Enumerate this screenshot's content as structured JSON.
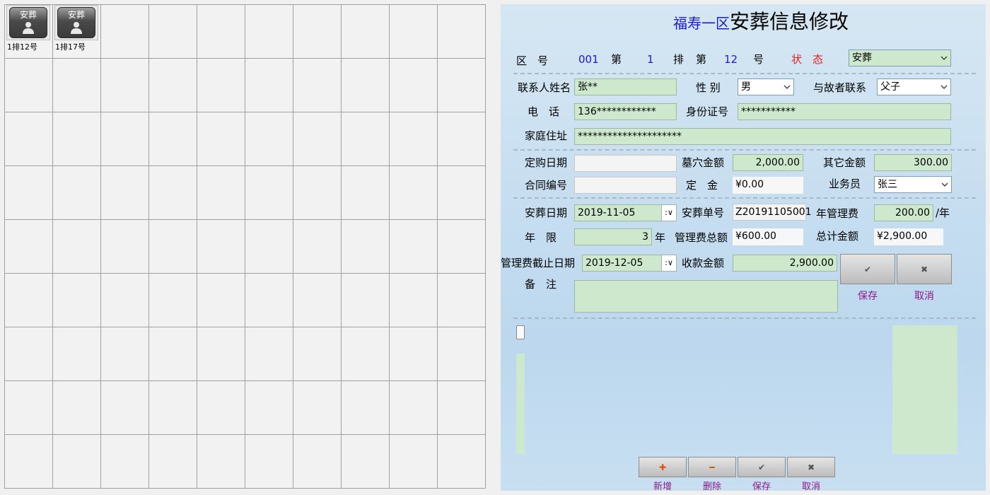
{
  "grid": {
    "rows": 9,
    "cols": 10,
    "plots": [
      {
        "label": "安葬",
        "caption": "1排12号"
      },
      {
        "label": "安葬",
        "caption": "1排17号"
      }
    ]
  },
  "form": {
    "title_area": "福寿一区",
    "title_main": "安葬信息修改",
    "location": {
      "area_label": "区　号",
      "area_value": "001",
      "row_prefix": "第",
      "row_value": "1",
      "row_suffix": "排",
      "num_prefix": "第",
      "num_value": "12",
      "num_suffix": "号",
      "status_label": "状　态",
      "status_value": "安葬"
    },
    "contact": {
      "name_label": "联系人姓名",
      "name_value": "张**",
      "gender_label": "性 别",
      "gender_value": "男",
      "relation_label": "与故者联系",
      "relation_value": "父子",
      "phone_label": "电　话",
      "phone_value": "136************",
      "id_label": "身份证号",
      "id_value": "***********",
      "address_label": "家庭住址",
      "address_value": "*********************"
    },
    "purchase": {
      "date_label": "定购日期",
      "date_value": "",
      "tomb_amount_label": "墓穴金额",
      "tomb_amount_value": "2,000.00",
      "other_amount_label": "其它金额",
      "other_amount_value": "300.00",
      "contract_label": "合同编号",
      "contract_value": "",
      "deposit_label": "定　金",
      "deposit_value": "¥0.00",
      "salesman_label": "业务员",
      "salesman_value": "张三"
    },
    "burial": {
      "date_label": "安葬日期",
      "date_value": "2019-11-05",
      "order_label": "安葬单号",
      "order_value": "Z20191105001",
      "fee_label": "年管理费",
      "fee_value": "200.00",
      "fee_unit": "/年",
      "years_label": "年　限",
      "years_value": "3",
      "years_unit": "年",
      "fee_total_label": "管理费总额",
      "fee_total_value": "¥600.00",
      "total_label": "总计金额",
      "total_value": "¥2,900.00",
      "deadline_label": "管理费截止日期",
      "deadline_value": "2019-12-05",
      "received_label": "收款金额",
      "received_value": "2,900.00",
      "note_label": "备　注",
      "note_value": ""
    },
    "actions": {
      "save_label": "保存",
      "cancel_label": "取消",
      "check_glyph": "✔",
      "cross_glyph": "✖"
    },
    "bottom_actions": {
      "add_label": "新增",
      "delete_label": "删除",
      "save_label": "保存",
      "cancel_label": "取消",
      "add_glyph": "✚",
      "delete_glyph": "━",
      "check_glyph": "✔",
      "cross_glyph": "✖"
    }
  },
  "colors": {
    "field_green": "#cde8cd",
    "title_blue": "#1a1ad8",
    "status_red": "#e02020",
    "caption_purple": "#8a1a8a"
  }
}
